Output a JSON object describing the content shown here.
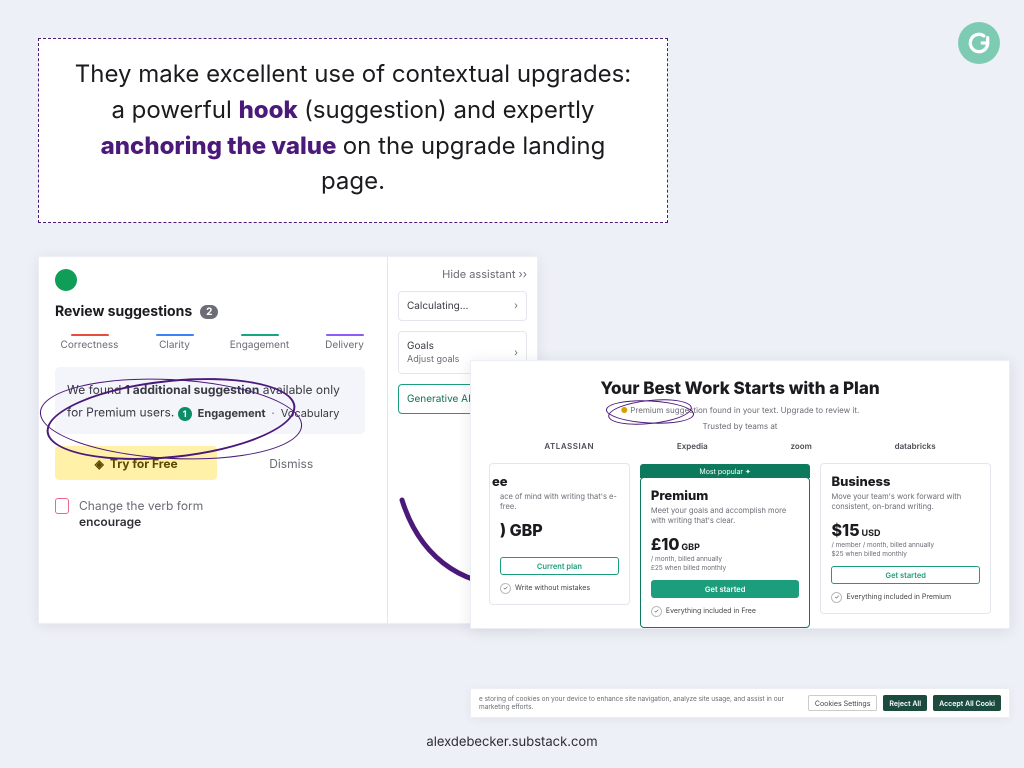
{
  "headline": {
    "pre": "They make excellent use of contextual upgrades: a powerful ",
    "hook": "hook",
    "mid1": " (suggestion) and expertly ",
    "anchor": "anchoring the value",
    "post": " on the upgrade landing page."
  },
  "badge": {
    "letter": "G"
  },
  "shotA": {
    "title": "Review suggestions",
    "count": "2",
    "tabs": [
      {
        "label": "Correctness",
        "color": "#e74c3c"
      },
      {
        "label": "Clarity",
        "color": "#3b82f6"
      },
      {
        "label": "Engagement",
        "color": "#15a683"
      },
      {
        "label": "Delivery",
        "color": "#8b5cf6"
      }
    ],
    "promo_pre": "We found ",
    "promo_bold": "1 additional suggestion",
    "promo_post": " available only for Premium users.",
    "pill_num": "1",
    "pill_cat": "Engagement",
    "pill_sub": "Vocabulary",
    "try_label": "Try for Free",
    "dismiss_label": "Dismiss",
    "verb_hint": "Change the verb form",
    "verb_word": "encourage",
    "assistant": {
      "hide": "Hide assistant ››",
      "calc": "Calculating...",
      "goals_title": "Goals",
      "goals_sub": "Adjust goals",
      "genai": "Generative AI"
    }
  },
  "shotB": {
    "title": "Your Best Work Starts with a Plan",
    "banner_pre": "Premium suggestion found in your text. Upgrade to review it.",
    "trusted": "Trusted by teams at",
    "logos": [
      "ATLASSIAN",
      "Expedia",
      "zoom",
      "databricks"
    ],
    "plans": [
      {
        "name": "ee",
        "partial": true,
        "desc": "ace of mind with writing that's e-free.",
        "price": ") GBP",
        "meta": "",
        "btn": "Current plan",
        "btn_style": "outline",
        "feature": "Write without mistakes"
      },
      {
        "name": "Premium",
        "popular": "Most popular ✦",
        "desc": "Meet your goals and accomplish more with writing that's clear.",
        "price": "£10",
        "currency": "GBP",
        "meta": "/ month, billed annually",
        "meta2": "£25 when billed monthly",
        "btn": "Get started",
        "btn_style": "solid",
        "feature": "Everything included in Free"
      },
      {
        "name": "Business",
        "desc": "Move your team's work forward with consistent, on-brand writing.",
        "price": "$15",
        "currency": "USD",
        "meta": "/ member / month, billed annually",
        "meta2": "$25 when billed monthly",
        "btn": "Get started",
        "btn_style": "outline",
        "feature": "Everything included in Premium"
      }
    ]
  },
  "cookies": {
    "text": "e storing of cookies on your device to enhance site navigation, analyze site usage, and assist in our marketing efforts.",
    "settings": "Cookies Settings",
    "reject": "Reject All",
    "accept": "Accept All Cooki"
  },
  "footer": "alexdebecker.substack.com"
}
